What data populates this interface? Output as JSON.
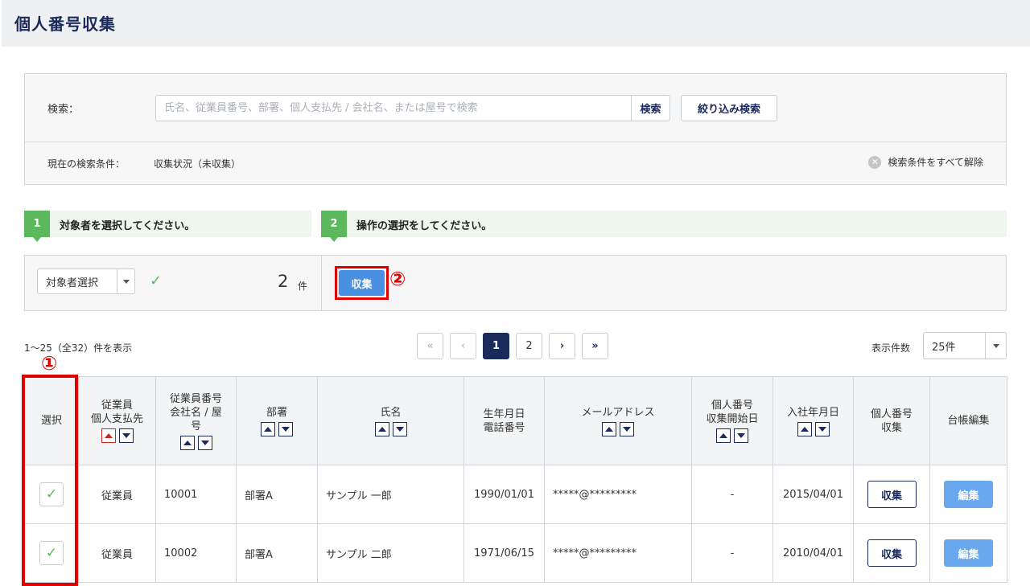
{
  "page": {
    "title": "個人番号収集"
  },
  "search": {
    "label": "検索：",
    "placeholder": "氏名、従業員番号、部署、個人支払先 / 会社名、または屋号で検索",
    "button": "検索",
    "filter_button": "絞り込み検索",
    "condition_label": "現在の検索条件：",
    "condition_value": "収集状況（未収集）",
    "clear_label": "検索条件をすべて解除"
  },
  "steps": [
    {
      "num": "1",
      "text": "対象者を選択してください。"
    },
    {
      "num": "2",
      "text": "操作の選択をしてください。"
    }
  ],
  "action": {
    "target_select": "対象者選択",
    "count": "2",
    "count_unit": "件",
    "collect_button": "収集",
    "annotation": "②"
  },
  "pagination": {
    "range_text": "1〜25（全32）件を表示",
    "first": "«",
    "prev": "‹",
    "pages": [
      "1",
      "2"
    ],
    "current": "1",
    "next": "›",
    "last": "»",
    "per_page_label": "表示件数",
    "per_page_value": "25件"
  },
  "table": {
    "annotation": "①",
    "headers": {
      "select": "選択",
      "employee_type_1": "従業員",
      "employee_type_2": "個人支払先",
      "employee_no_1": "従業員番号",
      "employee_no_2": "会社名 / 屋",
      "employee_no_3": "号",
      "department": "部署",
      "name": "氏名",
      "birth_1": "生年月日",
      "birth_2": "電話番号",
      "email": "メールアドレス",
      "mynumber_start_1": "個人番号",
      "mynumber_start_2": "収集開始日",
      "hire_date": "入社年月日",
      "mynumber_collect_1": "個人番号",
      "mynumber_collect_2": "収集",
      "ledger_edit": "台帳編集"
    },
    "rows": [
      {
        "checked": "✓",
        "type": "従業員",
        "no": "10001",
        "dept": "部署A",
        "name": "サンプル 一郎",
        "birth": "1990/01/01",
        "email": "*****@*********",
        "start": "-",
        "hire": "2015/04/01",
        "collect": "収集",
        "edit": "編集"
      },
      {
        "checked": "✓",
        "type": "従業員",
        "no": "10002",
        "dept": "部署A",
        "name": "サンプル 二郎",
        "birth": "1971/06/15",
        "email": "*****@*********",
        "start": "-",
        "hire": "2010/04/01",
        "collect": "収集",
        "edit": "編集"
      }
    ]
  },
  "colors": {
    "navy": "#1a2a5a",
    "green": "#5cb85c",
    "blue": "#4a90e2",
    "highlight_red": "#e00000"
  }
}
